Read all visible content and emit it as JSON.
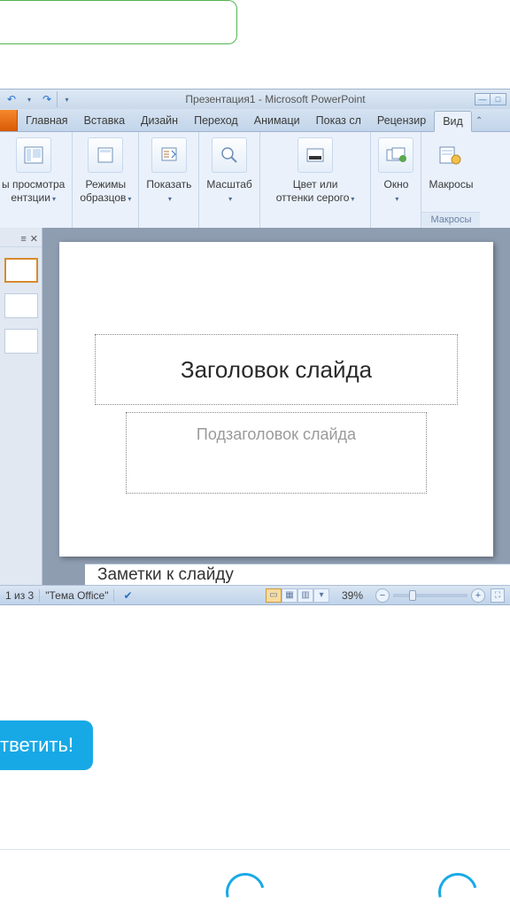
{
  "titlebar": {
    "text": "Презентация1  -  Microsoft PowerPoint"
  },
  "tabs": [
    "Главная",
    "Вставка",
    "Дизайн",
    "Переход",
    "Анимаци",
    "Показ сл",
    "Рецензир",
    "Вид"
  ],
  "ribbon": {
    "view_modes": {
      "line1": "ы просмотра",
      "line2": "ентзции"
    },
    "sample_modes": {
      "line1": "Режимы",
      "line2": "образцов"
    },
    "show": "Показать",
    "zoom": "Масштаб",
    "color": {
      "line1": "Цвет или",
      "line2": "оттенки серого"
    },
    "window": "Окно",
    "macros": "Макросы",
    "macros_caption": "Макросы"
  },
  "slide": {
    "title_placeholder": "Заголовок слайда",
    "subtitle_placeholder": "Подзаголовок слайда"
  },
  "notes_placeholder": "Заметки к слайду",
  "status": {
    "slide_counter": "1 из 3",
    "theme": "\"Тема Office\"",
    "zoom_pct": "39%"
  },
  "answer_button": "тветить!"
}
